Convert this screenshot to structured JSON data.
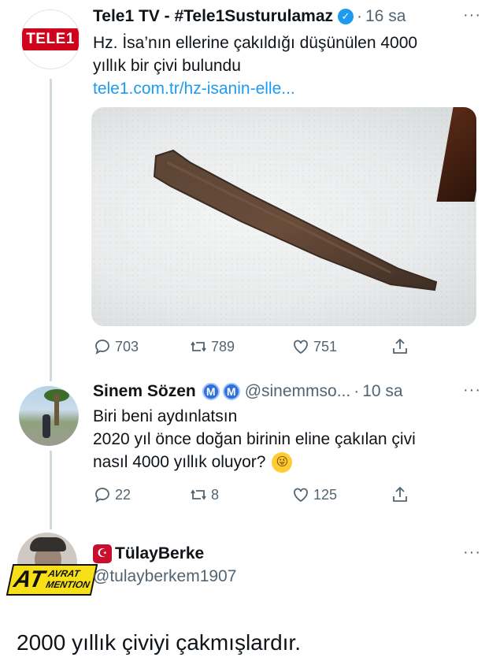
{
  "tweet1": {
    "author_name": "Tele1 TV - #Tele1Susturulamaz",
    "avatar_logo": "TELE1",
    "time": "16 sa",
    "text_line1": "Hz. İsa’nın ellerine çakıldığı düşünülen 4000",
    "text_line2": "yıllık bir çivi bulundu",
    "link": "tele1.com.tr/hz-isanin-elle...",
    "media_icon": "rusty-nail-photo",
    "replies": "703",
    "retweets": "789",
    "likes": "751"
  },
  "tweet2": {
    "author_name": "Sinem Sözen",
    "badges": [
      "M",
      "M"
    ],
    "handle": "@sinemmso...",
    "time": "10 sa",
    "text_line1": "Biri beni aydınlatsın",
    "text_line2": "2020 yıl önce doğan birinin eline çakılan çivi",
    "text_line3": "nasıl 4000 yıllık oluyor?",
    "emoji": "zany-face",
    "replies": "22",
    "retweets": "8",
    "likes": "125"
  },
  "tweet3": {
    "author_name": "TülayBerke",
    "handle": "@tulayberkem1907",
    "badge_big": "AT",
    "badge_small_1": "AVRAT",
    "badge_small_2": "MENTION"
  },
  "caption": "2000 yıllık çiviyi çakmışlardır.",
  "colors": {
    "link": "#1d9bf0",
    "muted": "#536471",
    "thread_line": "#cfd9de"
  }
}
